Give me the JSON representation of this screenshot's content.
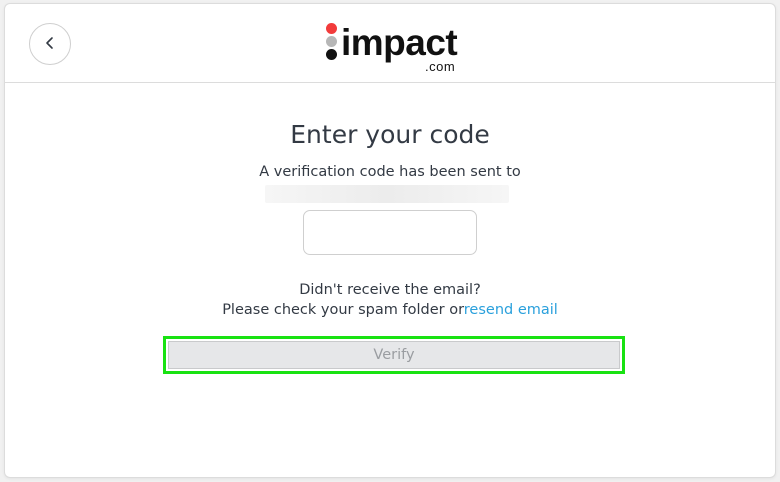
{
  "header": {
    "back_icon": "chevron-left-icon",
    "logo": {
      "wordmark": "impact",
      "suffix": ".com",
      "dot_colors": [
        "#f23b3b",
        "#b7b7b7",
        "#111111"
      ]
    }
  },
  "main": {
    "title": "Enter your code",
    "subtitle": "A verification code has been sent to",
    "code_input": {
      "value": "",
      "placeholder": ""
    },
    "help_line1": "Didn't receive the email?",
    "help_line2_prefix": "Please check your spam folder or",
    "resend_link": "resend email",
    "verify_button": "Verify"
  },
  "colors": {
    "link": "#2aa0dc",
    "highlight": "#18e212",
    "button_disabled_bg": "#e6e7e9",
    "button_disabled_text": "#9a9da1"
  }
}
